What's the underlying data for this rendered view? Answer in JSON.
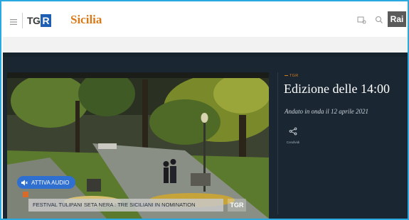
{
  "header": {
    "logo_text": "TGR",
    "region": "Sicilia",
    "brand": "Rai"
  },
  "video": {
    "audio_button_label": "ATTIVA AUDIO",
    "ticker_text": "FESTIVAL TULIPANI SETA NERA : TRE SICILIANI IN NOMINATION",
    "ticker_logo": "TGR"
  },
  "episode": {
    "eyebrow": "TGR",
    "title": "Edizione delle 14:00",
    "aired": "Andato in onda il 12 aprile 2021",
    "share_label": "Condividi"
  },
  "colors": {
    "accent_orange": "#d87a1a",
    "panel_bg": "#1a2733",
    "audio_button": "#2f6fd0",
    "frame_border": "#29a9e0"
  }
}
